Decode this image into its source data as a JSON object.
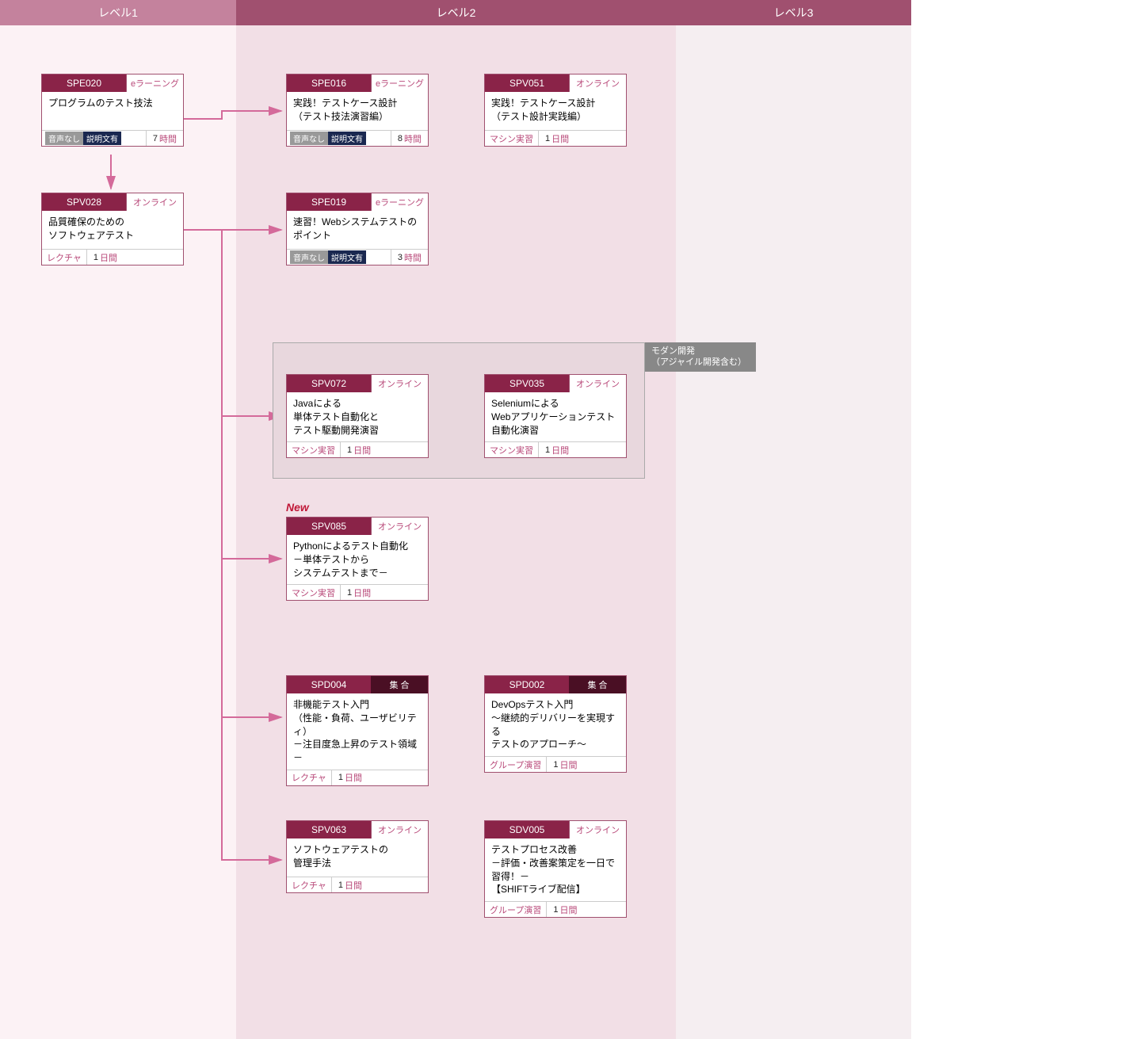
{
  "levels": {
    "l1": "レベル1",
    "l2": "レベル2",
    "l3": "レベル3"
  },
  "group_label": "モダン開発\n（アジャイル開発含む）",
  "new_label": "New",
  "cards": {
    "spe020": {
      "code": "SPE020",
      "type": "eラーニング",
      "title": "プログラムのテスト技法",
      "badge1": "音声なし",
      "badge2": "説明文有",
      "dur_num": "7",
      "dur_unit": "時間"
    },
    "spv028": {
      "code": "SPV028",
      "type": "オンライン",
      "title": "品質確保のための\nソフトウェアテスト",
      "metric": "レクチャ",
      "dur_num": "1",
      "dur_unit": "日間"
    },
    "spe016": {
      "code": "SPE016",
      "type": "eラーニング",
      "title": "実践！テストケース設計\n（テスト技法演習編）",
      "badge1": "音声なし",
      "badge2": "説明文有",
      "dur_num": "8",
      "dur_unit": "時間"
    },
    "spv051": {
      "code": "SPV051",
      "type": "オンライン",
      "title": "実践！テストケース設計\n（テスト設計実践編）",
      "metric": "マシン実習",
      "dur_num": "1",
      "dur_unit": "日間"
    },
    "spe019": {
      "code": "SPE019",
      "type": "eラーニング",
      "title": "速習！Webシステムテストの\nポイント",
      "badge1": "音声なし",
      "badge2": "説明文有",
      "dur_num": "3",
      "dur_unit": "時間"
    },
    "spv072": {
      "code": "SPV072",
      "type": "オンライン",
      "title": "Javaによる\n単体テスト自動化と\nテスト駆動開発演習",
      "metric": "マシン実習",
      "dur_num": "1",
      "dur_unit": "日間"
    },
    "spv035": {
      "code": "SPV035",
      "type": "オンライン",
      "title": "Seleniumによる\nWebアプリケーションテスト\n自動化演習",
      "metric": "マシン実習",
      "dur_num": "1",
      "dur_unit": "日間"
    },
    "spv085": {
      "code": "SPV085",
      "type": "オンライン",
      "title": "Pythonによるテスト自動化\n－単体テストから\nシステムテストまで－",
      "metric": "マシン実習",
      "dur_num": "1",
      "dur_unit": "日間"
    },
    "spd004": {
      "code": "SPD004",
      "type": "集 合",
      "title": "非機能テスト入門\n（性能・負荷、ユーザビリティ）\n－注目度急上昇のテスト領域－",
      "metric": "レクチャ",
      "dur_num": "1",
      "dur_unit": "日間"
    },
    "spd002": {
      "code": "SPD002",
      "type": "集 合",
      "title": "DevOpsテスト入門\n～継続的デリバリーを実現する\nテストのアプローチ～",
      "metric": "グループ演習",
      "dur_num": "1",
      "dur_unit": "日間"
    },
    "spv063": {
      "code": "SPV063",
      "type": "オンライン",
      "title": "ソフトウェアテストの\n管理手法",
      "metric": "レクチャ",
      "dur_num": "1",
      "dur_unit": "日間"
    },
    "sdv005": {
      "code": "SDV005",
      "type": "オンライン",
      "title": "テストプロセス改善\n－評価・改善案策定を一日で習得！－\n【SHIFTライブ配信】",
      "metric": "グループ演習",
      "dur_num": "1",
      "dur_unit": "日間"
    }
  }
}
